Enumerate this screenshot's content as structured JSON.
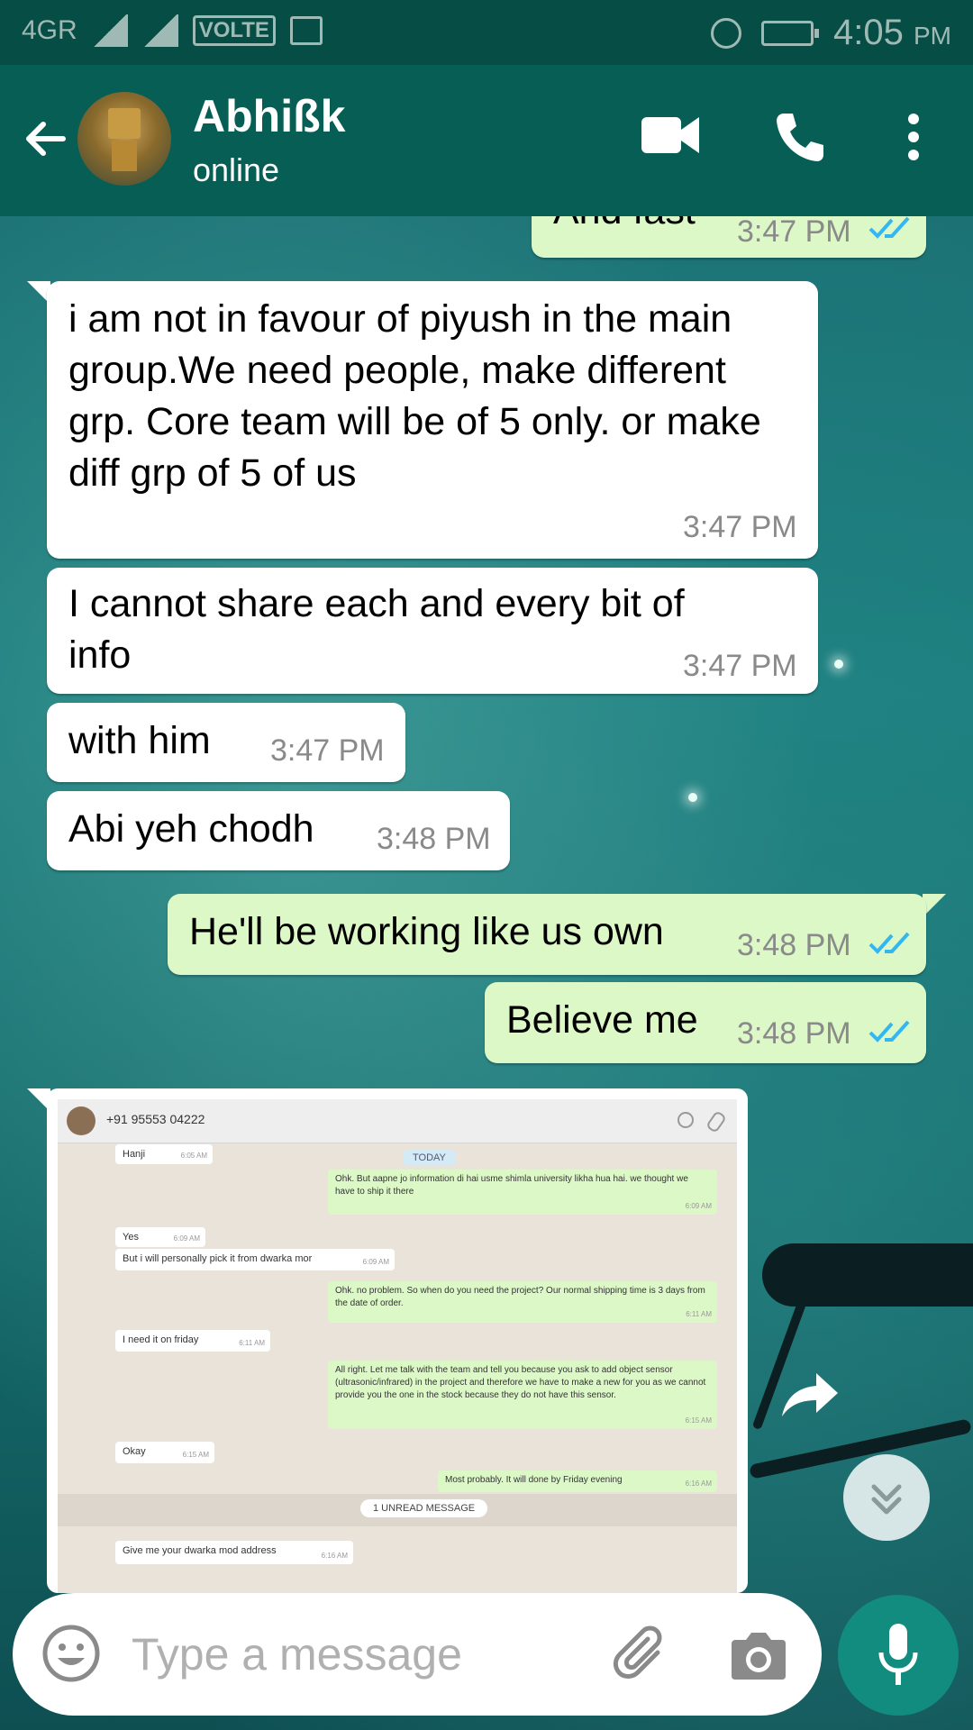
{
  "status_bar": {
    "network": "4GR",
    "volte": "VOLTE",
    "time": "4:05",
    "ampm": "PM"
  },
  "header": {
    "contact_name": "Abhißk",
    "contact_status": "online"
  },
  "messages": [
    {
      "dir": "out",
      "text": "And fast",
      "time": "3:47 PM",
      "read": true
    },
    {
      "dir": "in",
      "text": "i am not in favour of piyush in the main group.We need people, make different grp. Core team will be of 5 only. or make diff grp of 5 of us",
      "time": "3:47 PM"
    },
    {
      "dir": "in",
      "text": "I cannot share each and every bit of info",
      "time": "3:47 PM"
    },
    {
      "dir": "in",
      "text": "with him",
      "time": "3:47 PM"
    },
    {
      "dir": "in",
      "text": "Abi yeh chodh",
      "time": "3:48 PM"
    },
    {
      "dir": "out",
      "text": "He'll be working like us own",
      "time": "3:48 PM",
      "read": true
    },
    {
      "dir": "out",
      "text": "Believe me",
      "time": "3:48 PM",
      "read": true
    }
  ],
  "image_message": {
    "phone": "+91 95553 04222",
    "day_label": "TODAY",
    "unread_label": "1 UNREAD MESSAGE",
    "bubbles": [
      {
        "dir": "in",
        "text": "Hanji",
        "time": "6:05 AM"
      },
      {
        "dir": "out",
        "text": "Ohk. But aapne jo information di hai usme shimla university likha hua hai. we thought we have to ship it there",
        "time": "6:09 AM"
      },
      {
        "dir": "in",
        "text": "Yes",
        "time": "6:09 AM"
      },
      {
        "dir": "in",
        "text": "But i will personally pick it from dwarka mor",
        "time": "6:09 AM"
      },
      {
        "dir": "out",
        "text": "Ohk. no problem. So when do you need the project? Our normal shipping time is 3 days from the date of order.",
        "time": "6:11 AM"
      },
      {
        "dir": "in",
        "text": "I need it on friday",
        "time": "6:11 AM"
      },
      {
        "dir": "out",
        "text": "All right. Let me talk with the team and tell you because you ask to add object sensor (ultrasonic/infrared) in the project and therefore we have to make a new for you as we cannot provide you the one in the stock because they do not have this sensor.",
        "time": "6:15 AM"
      },
      {
        "dir": "in",
        "text": "Okay",
        "time": "6:15 AM"
      },
      {
        "dir": "out",
        "text": "Most probably. It will done by Friday evening",
        "time": "6:16 AM"
      },
      {
        "dir": "in",
        "text": "Give me your dwarka mod address",
        "time": "6:16 AM"
      }
    ]
  },
  "input": {
    "placeholder": "Type a message"
  },
  "colors": {
    "header": "#075e54",
    "status_bar": "#064e45",
    "outgoing_bubble": "#dcf8c6",
    "incoming_bubble": "#ffffff",
    "read_ticks": "#34b7f1",
    "mic_button": "#128c7e"
  },
  "icons": [
    "back-arrow-icon",
    "video-call-icon",
    "phone-icon",
    "more-vert-icon",
    "forward-icon",
    "scroll-down-icon",
    "emoji-icon",
    "attach-icon",
    "camera-icon",
    "mic-icon"
  ]
}
